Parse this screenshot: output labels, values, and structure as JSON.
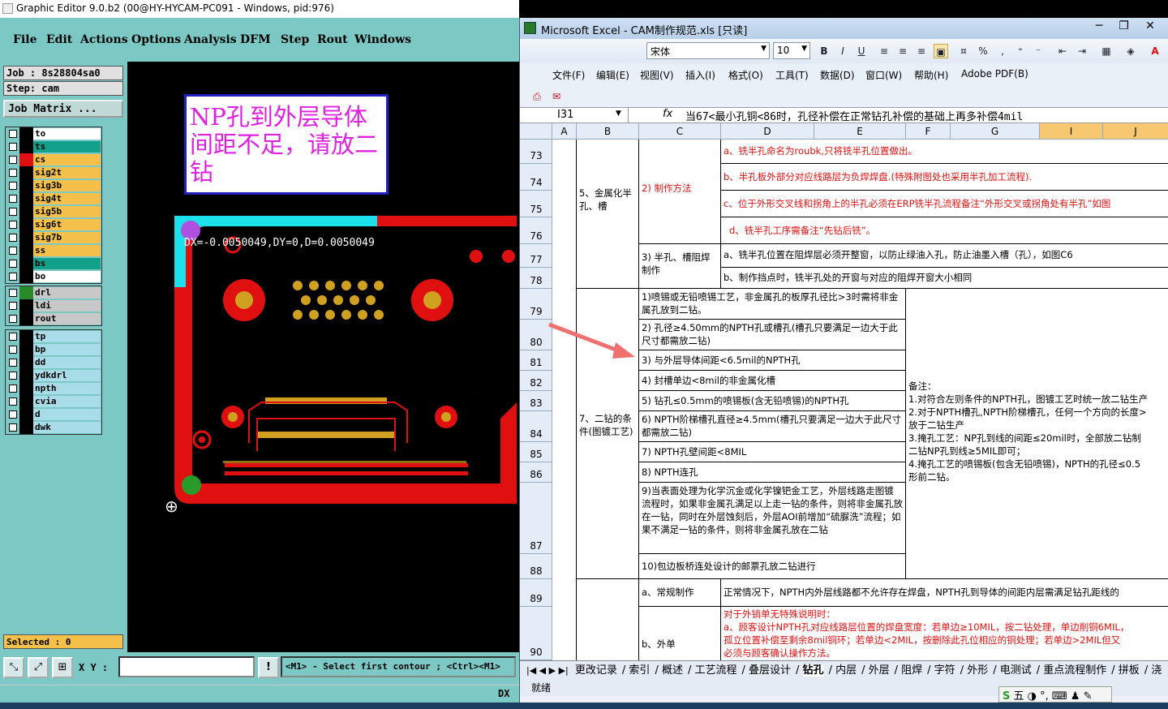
{
  "genesis": {
    "title": "Graphic Editor 9.0.b2 (00@HY-HYCAM-PC091 - Windows, pid:976)",
    "menu": [
      "File",
      "Edit",
      "Actions",
      "Options",
      "Analysis",
      "DFM",
      "Step",
      "Rout",
      "Windows"
    ],
    "job": "Job : 8s28804sa0",
    "step": "Step: cam",
    "job_matrix": "Job Matrix ...",
    "layers_group1": [
      {
        "name": "to",
        "color": "#ffffff",
        "swatch": "#000000"
      },
      {
        "name": "ts",
        "color": "#12a08a",
        "swatch": "#000000"
      },
      {
        "name": "cs",
        "color": "#f4c04a",
        "swatch": "#e01010"
      },
      {
        "name": "sig2t",
        "color": "#f4c04a",
        "swatch": "#000000"
      },
      {
        "name": "sig3b",
        "color": "#f4c04a",
        "swatch": "#000000"
      },
      {
        "name": "sig4t",
        "color": "#f4c04a",
        "swatch": "#000000"
      },
      {
        "name": "sig5b",
        "color": "#f4c04a",
        "swatch": "#000000"
      },
      {
        "name": "sig6t",
        "color": "#f4c04a",
        "swatch": "#000000"
      },
      {
        "name": "sig7b",
        "color": "#f4c04a",
        "swatch": "#000000"
      },
      {
        "name": "ss",
        "color": "#f4c04a",
        "swatch": "#000000"
      },
      {
        "name": "bs",
        "color": "#12a08a",
        "swatch": "#000000"
      },
      {
        "name": "bo",
        "color": "#ffffff",
        "swatch": "#000000"
      }
    ],
    "layers_group2": [
      {
        "name": "drl",
        "color": "#c8c8c8",
        "swatch": "#2a8a2a"
      },
      {
        "name": "ldi",
        "color": "#c8c8c8",
        "swatch": "#000000"
      },
      {
        "name": "rout",
        "color": "#c8c8c8",
        "swatch": "#000000"
      }
    ],
    "layers_group3": [
      {
        "name": "tp",
        "color": "#a8dce8",
        "swatch": "#000000"
      },
      {
        "name": "bp",
        "color": "#a8dce8",
        "swatch": "#000000"
      },
      {
        "name": "dd",
        "color": "#a8dce8",
        "swatch": "#000000"
      },
      {
        "name": "ydkdrl",
        "color": "#a8dce8",
        "swatch": "#000000"
      },
      {
        "name": "npth",
        "color": "#a8dce8",
        "swatch": "#000000"
      },
      {
        "name": "cvia",
        "color": "#a8dce8",
        "swatch": "#000000"
      },
      {
        "name": "d",
        "color": "#a8dce8",
        "swatch": "#000000"
      },
      {
        "name": "dwk",
        "color": "#a8dce8",
        "swatch": "#000000"
      }
    ],
    "selected": "Selected : 0",
    "xy_label": "X Y :",
    "prompt": "<M1> - Select first contour ; <Ctrl><M1>",
    "status_dx": "DX",
    "note_text": "NP孔到外层导体间距不足，请放二钻",
    "measure_text": "DX=-0.0050049,DY=0,D=0.0050049"
  },
  "excel": {
    "title": "Microsoft Excel - CAM制作规范.xls  [只读]",
    "font_name": "宋体",
    "font_size": "10",
    "menu": [
      "文件(F)",
      "编辑(E)",
      "视图(V)",
      "插入(I)",
      "格式(O)",
      "工具(T)",
      "数据(D)",
      "窗口(W)",
      "帮助(H)",
      "Adobe PDF(B)"
    ],
    "cell_ref": "I31",
    "fx": "fx",
    "formula": "当67<最小孔铜<86时，孔径补偿在正常钻孔补偿的基础上再多补偿4mil",
    "columns": [
      "A",
      "B",
      "C",
      "D",
      "E",
      "F",
      "G",
      "I",
      "J"
    ],
    "rows": [
      "73",
      "74",
      "75",
      "76",
      "77",
      "78",
      "79",
      "80",
      "81",
      "82",
      "83",
      "84",
      "85",
      "86",
      "87",
      "88",
      "89",
      "90"
    ],
    "b_metal": "5、金属化半孔、槽",
    "c_method": "2) 制作方法",
    "d73": "a、铣半孔命名为roubk,只将铣半孔位置做出。",
    "d74": "b、半孔板外部分对应线路层为负焊焊盘.(特殊附图处也采用半孔加工流程).",
    "d75": "c、位于外形交叉线和拐角上的半孔必须在ERP铣半孔流程备注“外形交叉或拐角处有半孔”如图",
    "d76": "d、铣半孔工序需备注“先钻后铣”。",
    "c_window": "3) 半孔、槽阻焊制作",
    "d77": "a、铣半孔位置在阻焊层必须开整窗，以防止绿油入孔，防止油墨入槽（孔），如图C6",
    "d78": "b、制作挡点时，铣半孔处的开窗与对应的阻焊开窗大小相同",
    "b_second": "7、二钻的条件(图镀工艺)",
    "c79": "1)喷锡或无铅喷锡工艺，非金属孔的板厚孔径比>3时需将非金属孔放到二钻。",
    "c80": "2) 孔径≥4.50mm的NPTH孔或槽孔(槽孔只要满足一边大于此尺寸都需放二钻)",
    "c81": "3) 与外层导体间距<6.5mil的NPTH孔",
    "c82": "4) 封槽单边<8mil的非金属化槽",
    "c83": "5) 钻孔≤0.5mm的喷锡板(含无铅喷锡)的NPTH孔",
    "c84": "6) NPTH阶梯槽孔直径≥4.5mm(槽孔只要满足一边大于此尺寸都需放二钻)",
    "c85": "7) NPTH孔壁间距<8MIL",
    "c86": "8) NPTH连孔",
    "c87": "9)当表面处理为化学沉金或化学镍钯金工艺，外层线路走图镀流程时，如果非金属孔满足以上走一钻的条件，则将非金属孔放在一钻，同时在外层蚀刻后，外层AOI前增加“硫脲洗”流程；如果不满足一钻的条件，则将非金属孔放在二钻",
    "c88": "10)包边板桥连处设计的邮票孔放二钻进行",
    "remark": "备注：\n1.对符合左则条件的NPTH孔，图镀工艺时统一放二钻生产\n2.对于NPTH槽孔,NPTH阶梯槽孔，任何一个方向的长度>\n放于二钻生产\n3.掩孔工艺：NP孔到线的间距≤20mil时，全部放二钻制\n二钻NP孔到线≥5MIL即可；\n4.掩孔工艺的喷锡板(包含无铅喷锡)，NPTH的孔径≤0.5\n形前二钻。",
    "c89": "a、常规制作",
    "d89": "正常情况下，NPTH内外层线路都不允许存在焊盘，NPTH孔到导体的间距内层需满足钻孔距线的",
    "c90": "b、外单",
    "d90": "对于外销单无特殊说明时：\na、顾客设计NPTH孔对应线路层位置的焊盘宽度：若单边≥10MIL，按二钻处理，单边削铜6MIL，\n孤立位置补偿至剩余8mil铜环；若单边<2MIL，按删除此孔位相应的铜处理；若单边>2MIL但又\n必须与顾客确认操作方法。",
    "tabs": [
      "更改记录",
      "索引",
      "概述",
      "工艺流程",
      "叠层设计",
      "钻孔",
      "内层",
      "外层",
      "阻焊",
      "字符",
      "外形",
      "电测试",
      "重点流程制作",
      "拼板",
      "浇"
    ],
    "status": "就绪",
    "ime": "五 ◑ °, ⌨ ♟ ✎"
  }
}
